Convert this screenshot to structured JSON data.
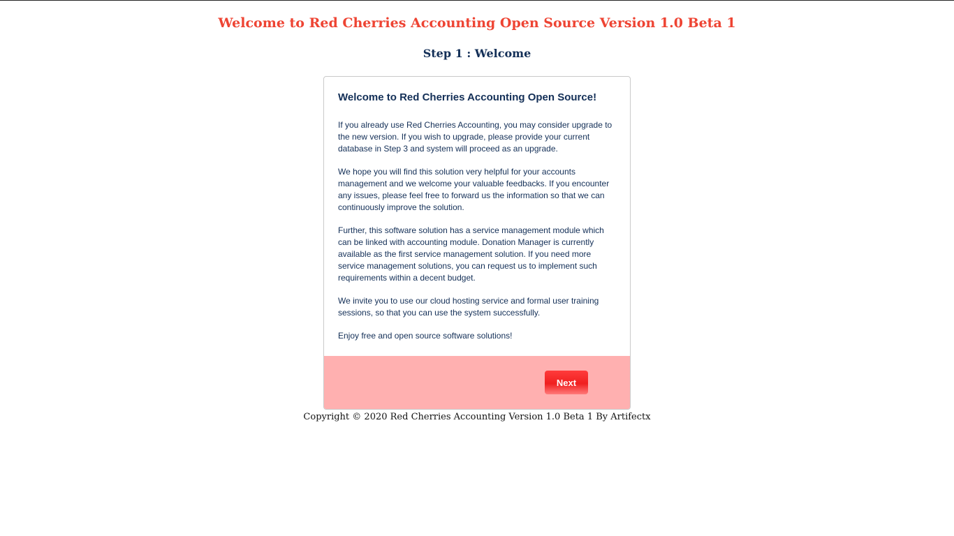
{
  "header": {
    "title": "Welcome to Red Cherries Accounting Open Source Version 1.0 Beta 1",
    "step": "Step 1 : Welcome"
  },
  "card": {
    "heading": "Welcome to Red Cherries Accounting Open Source!",
    "paragraphs": [
      "If you already use Red Cherries Accounting, you may consider upgrade to the new version. If you wish to upgrade, please provide your current database in Step 3 and system will proceed as an upgrade.",
      "We hope you will find this solution very helpful for your accounts management and we welcome your valuable feedbacks. If you encounter any issues, please feel free to forward us the information so that we can continuously improve the solution.",
      "Further, this software solution has a service management module which can be linked with accounting module. Donation Manager is currently available as the first service management solution. If you need more service management solutions, you can request us to implement such requirements within a decent budget.",
      "We invite you to use our cloud hosting service and formal user training sessions, so that you can use the system successfully.",
      "Enjoy free and open source software solutions!"
    ],
    "next_label": "Next"
  },
  "footer": {
    "copyright": "Copyright © 2020 Red Cherries Accounting Version 1.0 Beta 1 By Artifectx"
  },
  "colors": {
    "title": "#ee4433",
    "navy": "#132f57",
    "footer_band": "#ffb0b0",
    "button": "#f02020"
  }
}
